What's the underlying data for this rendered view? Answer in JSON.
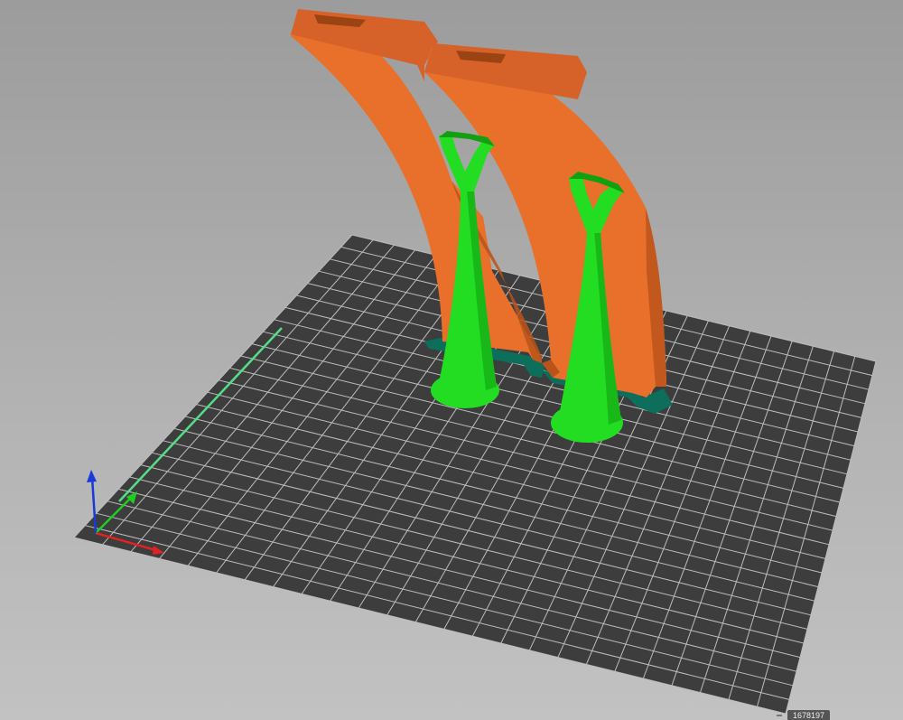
{
  "viewport": {
    "background_top": "#9c9c9c",
    "background_bottom": "#c2c2c2"
  },
  "bed": {
    "fill": "#3d3d3d",
    "grid_color": "#bdbdbd",
    "grid_divisions": 25
  },
  "colors": {
    "object_orange": "#e8702a",
    "object_orange_dark": "#b8531a",
    "object_orange_light": "#f28a40",
    "support_green": "#22dd22",
    "support_green_dark": "#12a012",
    "brim_teal": "#0e6e5c",
    "axis_x": "#e22222",
    "axis_y": "#22cc22",
    "axis_z": "#1a3ad8",
    "edge_highlight": "#55dd88"
  },
  "axes_icon": {
    "x_label": "x-axis",
    "y_label": "y-axis",
    "z_label": "z-axis"
  },
  "status": {
    "object_count_readout": "1678197"
  }
}
